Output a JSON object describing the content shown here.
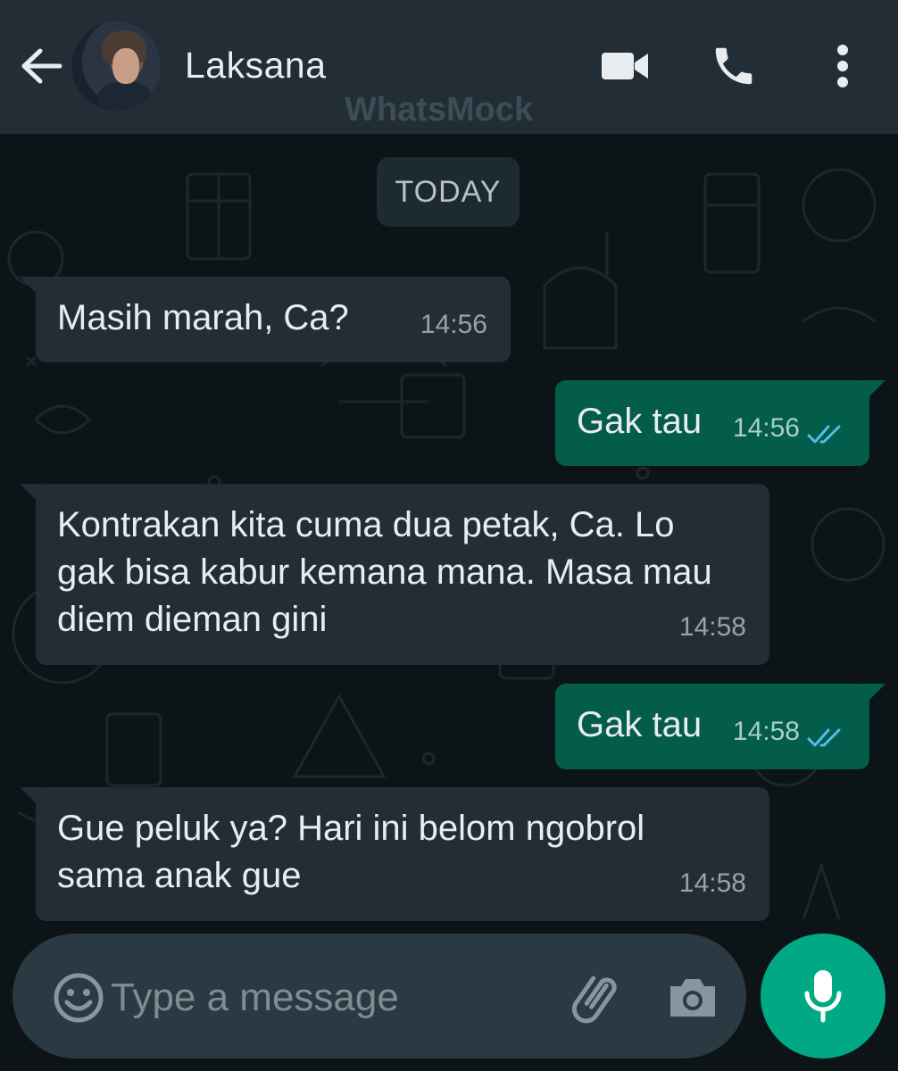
{
  "header": {
    "contact_name": "Laksana",
    "watermark": "WhatsMock",
    "icons": {
      "back": "back-arrow-icon",
      "video": "video-call-icon",
      "call": "phone-icon",
      "menu": "more-vertical-icon"
    }
  },
  "chat": {
    "date_label": "TODAY",
    "messages": [
      {
        "direction": "incoming",
        "text": "Masih marah, Ca?",
        "time": "14:56"
      },
      {
        "direction": "outgoing",
        "text": "Gak tau",
        "time": "14:56",
        "status": "read"
      },
      {
        "direction": "incoming",
        "text": "Kontrakan kita cuma dua petak, Ca. Lo gak bisa kabur kemana mana. Masa mau diem dieman gini",
        "time": "14:58"
      },
      {
        "direction": "outgoing",
        "text": "Gak tau",
        "time": "14:58",
        "status": "read"
      },
      {
        "direction": "incoming",
        "text": "Gue peluk ya? Hari ini belom ngobrol sama anak gue",
        "time": "14:58"
      }
    ]
  },
  "composer": {
    "placeholder": "Type a message",
    "icons": {
      "emoji": "emoji-icon",
      "attach": "paperclip-icon",
      "camera": "camera-icon",
      "mic": "microphone-icon"
    }
  },
  "colors": {
    "header_bg": "#232d36",
    "chat_bg": "#0d1418",
    "incoming_bubble": "#232d36",
    "outgoing_bubble": "#045c4b",
    "read_ticks": "#53bdeb",
    "accent": "#00a884"
  }
}
